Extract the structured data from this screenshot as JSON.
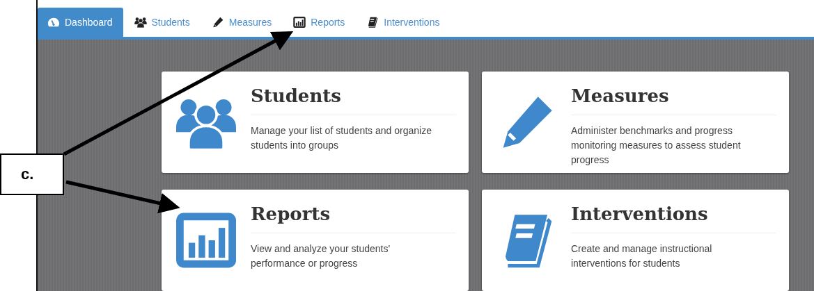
{
  "tabs": [
    {
      "label": "Dashboard",
      "kind": "dashboard",
      "selected": true
    },
    {
      "label": "Students",
      "kind": "students",
      "selected": false
    },
    {
      "label": "Measures",
      "kind": "measures",
      "selected": false
    },
    {
      "label": "Reports",
      "kind": "reports",
      "selected": false
    },
    {
      "label": "Interventions",
      "kind": "interventions",
      "selected": false
    }
  ],
  "cards": [
    {
      "title": "Students",
      "kind": "students",
      "description": "Manage your list of students and organize students into groups"
    },
    {
      "title": "Measures",
      "kind": "measures",
      "description": "Administer benchmarks and progress monitoring measures to assess student progress"
    },
    {
      "title": "Reports",
      "kind": "reports",
      "description": "View and analyze your students' performance or progress"
    },
    {
      "title": "Interventions",
      "kind": "interventions",
      "description": "Create and manage instructional interventions for students"
    }
  ],
  "callout": {
    "label": "c."
  }
}
